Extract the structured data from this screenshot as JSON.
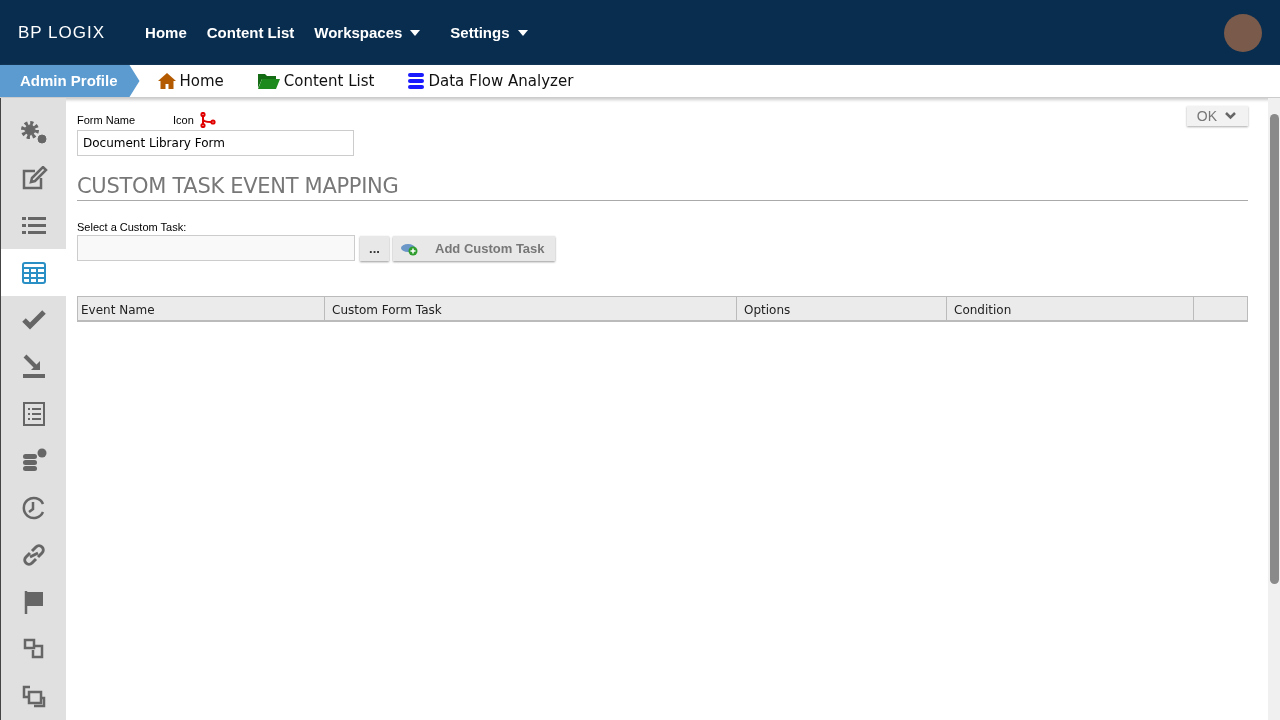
{
  "header": {
    "logo": "BP LOGIX",
    "nav": [
      {
        "label": "Home",
        "dropdown": false
      },
      {
        "label": "Content List",
        "dropdown": false
      },
      {
        "label": "Workspaces",
        "dropdown": true
      },
      {
        "label": "Settings",
        "dropdown": true
      }
    ]
  },
  "breadcrumb": {
    "profile": "Admin Profile",
    "links": [
      {
        "kind": "home",
        "label": "Home"
      },
      {
        "kind": "folder",
        "label": "Content List"
      },
      {
        "kind": "database",
        "label": "Data Flow Analyzer"
      }
    ]
  },
  "sidebar": {
    "items": [
      {
        "kind": "gears",
        "selected": false
      },
      {
        "kind": "edit",
        "selected": false
      },
      {
        "kind": "list",
        "selected": false
      },
      {
        "kind": "table",
        "selected": true
      },
      {
        "kind": "check",
        "selected": false
      },
      {
        "kind": "import",
        "selected": false
      },
      {
        "kind": "form",
        "selected": false
      },
      {
        "kind": "database-add",
        "selected": false
      },
      {
        "kind": "clock",
        "selected": false
      },
      {
        "kind": "link",
        "selected": false
      },
      {
        "kind": "flag",
        "selected": false
      },
      {
        "kind": "restore",
        "selected": false
      },
      {
        "kind": "copy",
        "selected": false
      }
    ]
  },
  "form": {
    "name_label": "Form Name",
    "icon_label": "Icon",
    "name_value": "Document Library Form",
    "ok_button": "OK"
  },
  "section": {
    "title": "CUSTOM TASK EVENT MAPPING",
    "select_label": "Select a Custom Task:",
    "browse_button": "...",
    "add_button": "Add Custom Task"
  },
  "table": {
    "columns": [
      "Event Name",
      "Custom Form Task",
      "Options",
      "Condition"
    ]
  }
}
